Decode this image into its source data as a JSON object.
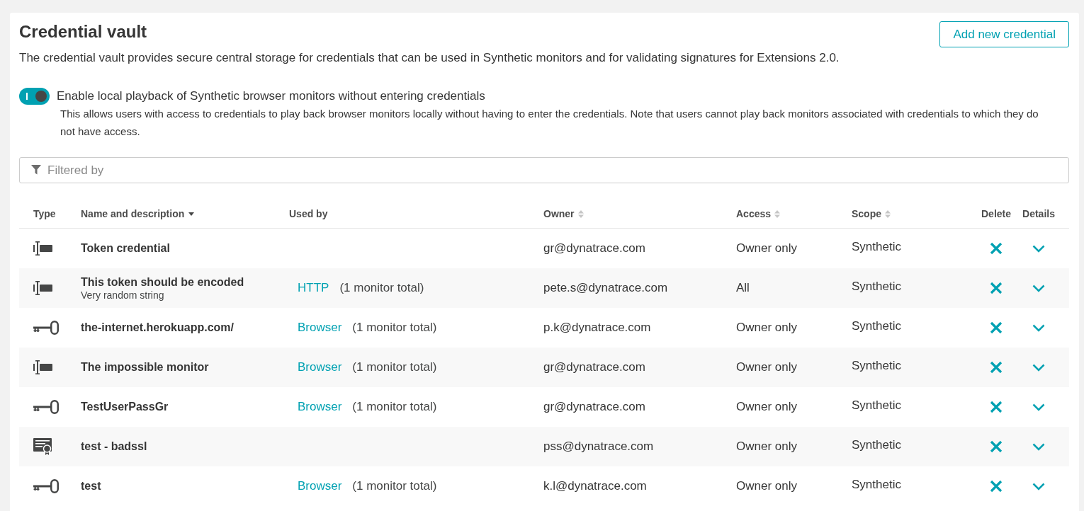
{
  "page": {
    "title": "Credential vault",
    "description": "The credential vault provides secure central storage for credentials that can be used in Synthetic monitors and for validating signatures for Extensions 2.0.",
    "add_button": "Add new credential"
  },
  "playback_toggle": {
    "on": true,
    "label": "Enable local playback of Synthetic browser monitors without entering credentials",
    "note": "This allows users with access to credentials to play back browser monitors locally without having to enter the credentials. Note that users cannot play back monitors associated with credentials to which they do not have access."
  },
  "filter": {
    "placeholder": "Filtered by"
  },
  "table": {
    "columns": [
      {
        "label": "Type",
        "sortable": false
      },
      {
        "label": "Name and description",
        "sortable": true,
        "sorted": true
      },
      {
        "label": "Used by",
        "sortable": false
      },
      {
        "label": "Owner",
        "sortable": true,
        "sorted": false
      },
      {
        "label": "Access",
        "sortable": true,
        "sorted": false
      },
      {
        "label": "Scope",
        "sortable": true,
        "sorted": false
      },
      {
        "label": "Delete",
        "sortable": false
      },
      {
        "label": "Details",
        "sortable": false
      }
    ],
    "rows": [
      {
        "kind": "token",
        "name": "Token credential",
        "owner": "gr@dynatrace.com",
        "access": "Owner only",
        "scope": "Synthetic",
        "expanded": false
      },
      {
        "kind": "token",
        "name": "This token should be encoded",
        "description": "Very random string",
        "used_by": {
          "link": "HTTP",
          "total": "(1 monitor total)"
        },
        "owner": "pete.s@dynatrace.com",
        "access": "All",
        "scope": "Synthetic",
        "expanded": false
      },
      {
        "kind": "user_password",
        "name": "the-internet.herokuapp.com/",
        "used_by": {
          "link": "Browser",
          "total": "(1 monitor total)"
        },
        "owner": "p.k@dynatrace.com",
        "access": "Owner only",
        "scope": "Synthetic",
        "expanded": false
      },
      {
        "kind": "token",
        "name": "The impossible monitor",
        "used_by": {
          "link": "Browser",
          "total": "(1 monitor total)"
        },
        "owner": "gr@dynatrace.com",
        "access": "Owner only",
        "scope": "Synthetic",
        "expanded": false
      },
      {
        "kind": "user_password",
        "name": "TestUserPassGr",
        "used_by": {
          "link": "Browser",
          "total": "(1 monitor total)"
        },
        "owner": "gr@dynatrace.com",
        "access": "Owner only",
        "scope": "Synthetic",
        "expanded": false
      },
      {
        "kind": "certificate",
        "name": "test - badssl",
        "owner": "pss@dynatrace.com",
        "access": "Owner only",
        "scope": "Synthetic",
        "expanded": false
      },
      {
        "kind": "user_password",
        "name": "test",
        "used_by": {
          "link": "Browser",
          "total": "(1 monitor total)"
        },
        "owner": "k.l@dynatrace.com",
        "access": "Owner only",
        "scope": "Synthetic",
        "expanded": false
      }
    ]
  }
}
